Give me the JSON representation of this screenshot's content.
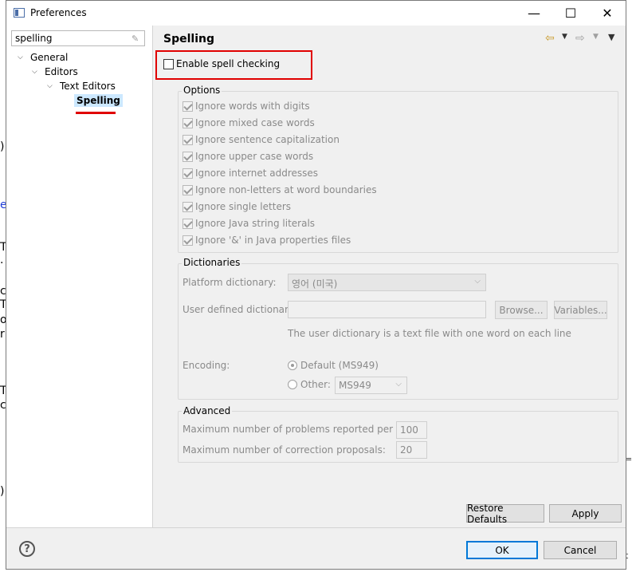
{
  "window": {
    "title": "Preferences",
    "minimize_glyph": "—",
    "maximize_glyph": "☐",
    "close_glyph": "✕"
  },
  "background_editor": {
    "glyphs": [
      ")",
      "e",
      "T",
      ".",
      "c",
      "T",
      "o",
      "r",
      "T",
      "c",
      ")"
    ],
    "right_glyphs": [
      "=",
      "t"
    ]
  },
  "left": {
    "filter": {
      "value": "spelling"
    },
    "tree": {
      "general": "General",
      "editors": "Editors",
      "text_editors": "Text Editors",
      "spelling": "Spelling"
    }
  },
  "right": {
    "title": "Spelling",
    "enable_spell_checking": {
      "label": "Enable spell checking",
      "checked": false
    },
    "options": {
      "title": "Options",
      "items": [
        {
          "label": "Ignore words with digits",
          "checked": true
        },
        {
          "label": "Ignore mixed case words",
          "checked": true
        },
        {
          "label": "Ignore sentence capitalization",
          "checked": true
        },
        {
          "label": "Ignore upper case words",
          "checked": true
        },
        {
          "label": "Ignore internet addresses",
          "checked": true
        },
        {
          "label": "Ignore non-letters at word boundaries",
          "checked": true
        },
        {
          "label": "Ignore single letters",
          "checked": true
        },
        {
          "label": "Ignore Java string literals",
          "checked": true
        },
        {
          "label": "Ignore '&' in Java properties files",
          "checked": true
        }
      ]
    },
    "dictionaries": {
      "title": "Dictionaries",
      "platform_label": "Platform dictionary:",
      "platform_value": "영어 (미국)",
      "user_label": "User defined dictionary:",
      "user_value": "",
      "browse_label": "Browse...",
      "variables_label": "Variables...",
      "hint": "The user dictionary is a text file with one word on each line",
      "encoding_label": "Encoding:",
      "default_label": "Default (MS949)",
      "other_label": "Other:",
      "other_value": "MS949"
    },
    "advanced": {
      "title": "Advanced",
      "max_problems_label": "Maximum number of problems reported per file:",
      "max_problems_value": "100",
      "max_proposals_label": "Maximum number of correction proposals:",
      "max_proposals_value": "20"
    },
    "restore_defaults_label": "Restore Defaults",
    "apply_label": "Apply"
  },
  "footer": {
    "help_glyph": "?",
    "ok_label": "OK",
    "cancel_label": "Cancel"
  },
  "colors": {
    "highlight_red": "#e00000",
    "selection_bg": "#cce8ff",
    "default_button_border": "#0078d7"
  }
}
